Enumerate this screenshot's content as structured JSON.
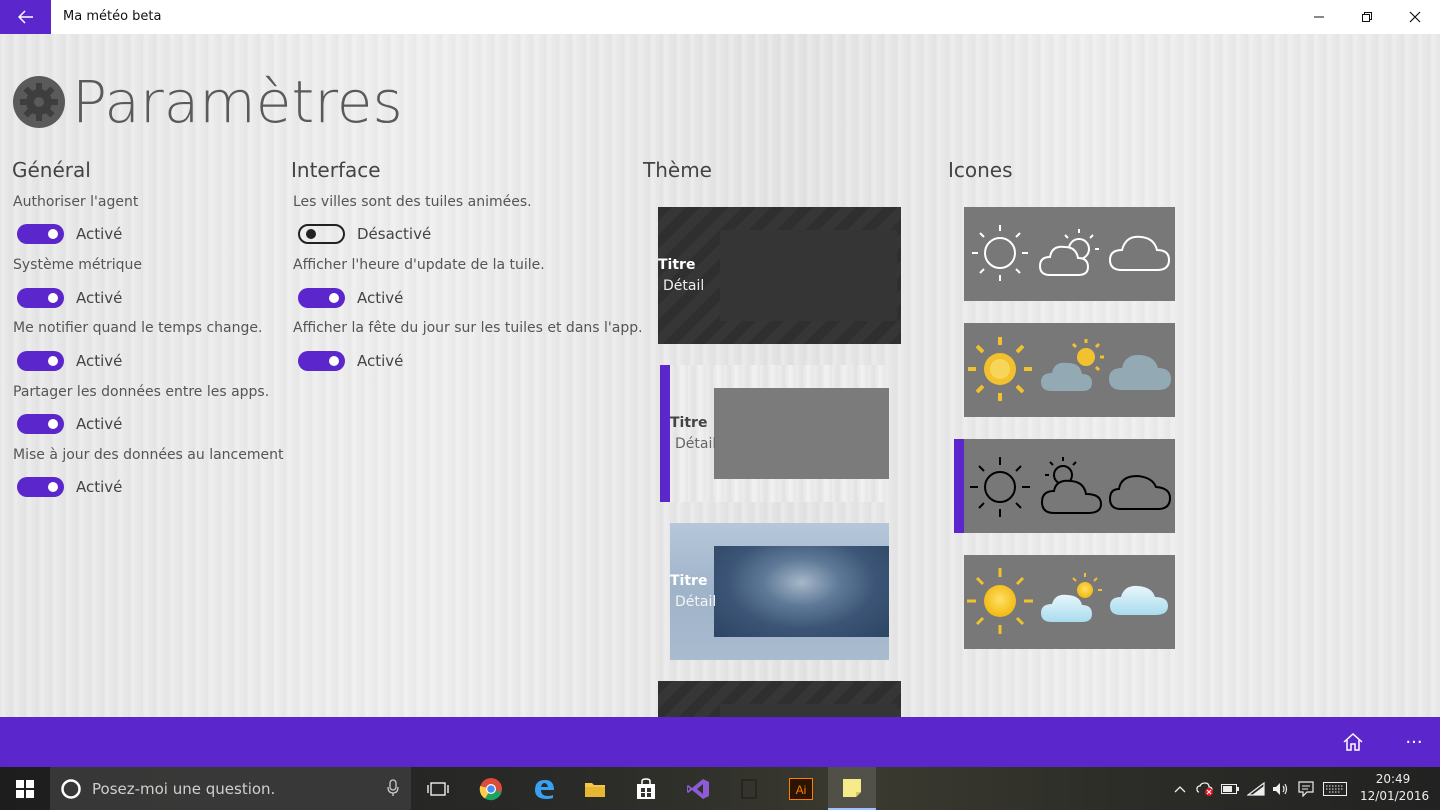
{
  "window": {
    "title": "Ma météo beta"
  },
  "page": {
    "title": "Paramètres"
  },
  "general": {
    "heading": "Général",
    "options": [
      {
        "label": "Authoriser l'agent",
        "state": "Activé",
        "on": true
      },
      {
        "label": "Système métrique",
        "state": "Activé",
        "on": true
      },
      {
        "label": "Me notifier quand le temps change.",
        "state": "Activé",
        "on": true
      },
      {
        "label": "Partager les données entre les apps.",
        "state": "Activé",
        "on": true
      },
      {
        "label": "Mise à jour des données au lancement",
        "state": "Activé",
        "on": true
      }
    ]
  },
  "interface": {
    "heading": "Interface",
    "options": [
      {
        "label": "Les villes sont des tuiles animées.",
        "state": "Désactivé",
        "on": false
      },
      {
        "label": "Afficher l'heure d'update de la tuile.",
        "state": "Activé",
        "on": true
      },
      {
        "label": "Afficher la fête du jour sur les tuiles et dans l'app.",
        "state": "Activé",
        "on": true
      }
    ]
  },
  "theme": {
    "heading": "Thème",
    "tiles": [
      {
        "title": "Titre",
        "detail": "Détail",
        "style": "dark",
        "selected": false
      },
      {
        "title": "Titre",
        "detail": "Détail",
        "style": "light",
        "selected": true
      },
      {
        "title": "Titre",
        "detail": "Détail",
        "style": "sky",
        "selected": false
      },
      {
        "title": "",
        "detail": "",
        "style": "dark",
        "selected": false
      }
    ]
  },
  "icons": {
    "heading": "Icones",
    "sets": [
      {
        "name": "outline-white",
        "selected": false
      },
      {
        "name": "color-flat",
        "selected": false
      },
      {
        "name": "outline-black",
        "selected": true
      },
      {
        "name": "color-gradient",
        "selected": false
      }
    ]
  },
  "commandbar": {
    "icons": [
      "home-icon",
      "more-icon"
    ],
    "more_label": "···"
  },
  "taskbar": {
    "search_placeholder": "Posez-moi une question.",
    "apps": [
      "task-view-icon",
      "chrome-icon",
      "edge-icon",
      "file-explorer-icon",
      "store-icon",
      "visual-studio-icon",
      "calculator-icon",
      "illustrator-icon",
      "sticky-notes-icon"
    ],
    "clock_time": "20:49",
    "clock_date": "12/01/2016"
  },
  "colors": {
    "accent": "#5b27cc",
    "icon_tile": "#787878"
  }
}
